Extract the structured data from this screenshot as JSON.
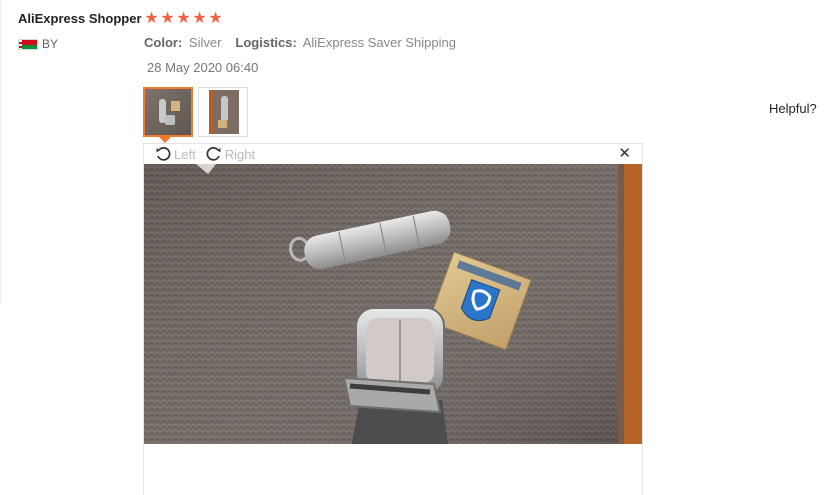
{
  "reviewer": {
    "name": "AliExpress Shopper",
    "country_code": "BY"
  },
  "rating": {
    "stars": 5,
    "max": 5
  },
  "review": {
    "color_label": "Color:",
    "color_value": "Silver",
    "logistics_label": "Logistics:",
    "logistics_value": "AliExpress Saver Shipping",
    "date": "28 May 2020 06:40"
  },
  "helpful_label": "Helpful?",
  "viewer": {
    "rotate_left_label": "Left",
    "rotate_right_label": "Right",
    "close_glyph": "✕"
  },
  "colors": {
    "star": "#f3604b",
    "active_thumb_border": "#f2792e",
    "text_secondary": "#888888"
  },
  "icons": [
    "rotate-left-icon",
    "rotate-right-icon",
    "close-icon",
    "star-icon",
    "belarus-flag-icon"
  ]
}
